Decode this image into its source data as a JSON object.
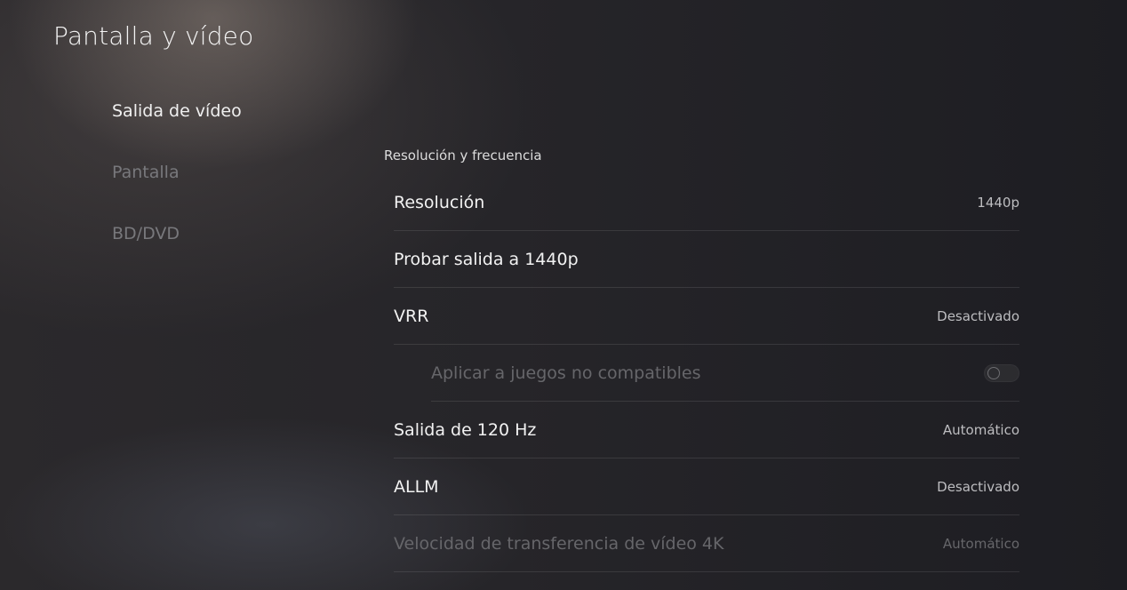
{
  "page": {
    "title": "Pantalla y vídeo"
  },
  "sidebar": {
    "items": [
      {
        "label": "Salida de vídeo",
        "active": true
      },
      {
        "label": "Pantalla",
        "active": false
      },
      {
        "label": "BD/DVD",
        "active": false
      }
    ]
  },
  "section": {
    "label": "Resolución y frecuencia"
  },
  "settings": [
    {
      "label": "Resolución",
      "value": "1440p"
    },
    {
      "label": "Probar salida a 1440p",
      "value": ""
    },
    {
      "label": "VRR",
      "value": "Desactivado"
    },
    {
      "label": "Aplicar a juegos no compatibles",
      "toggle": "off",
      "disabled": true
    },
    {
      "label": "Salida de 120 Hz",
      "value": "Automático"
    },
    {
      "label": "ALLM",
      "value": "Desactivado"
    },
    {
      "label": "Velocidad de transferencia de vídeo 4K",
      "value": "Automático",
      "disabled": true
    }
  ]
}
